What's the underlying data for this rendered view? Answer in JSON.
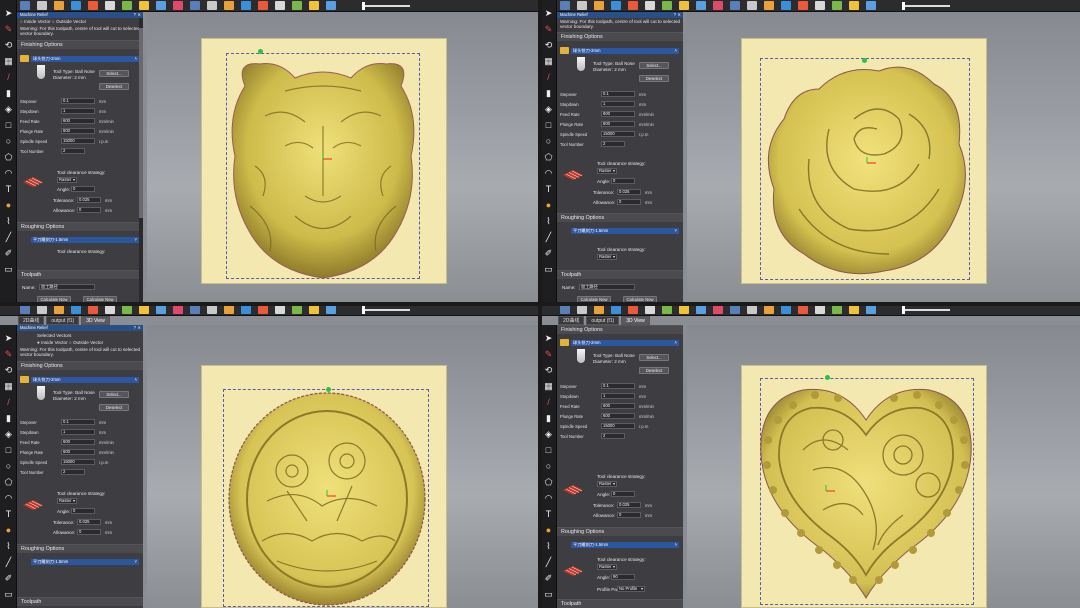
{
  "colors": {
    "accent": "#2d56a0",
    "relief": "#d9c85a",
    "sheet": "#f3e8b0",
    "box": "#5b5bb0"
  },
  "toolbar_icons": [
    "select-icon",
    "arrange-icon",
    "move-icon",
    "pointer-icon",
    "layers-icon",
    "measure-icon",
    "cube-icon",
    "box-icon",
    "diamond-icon",
    "box-icon",
    "box-icon",
    "box-icon",
    "diamond-icon",
    "box-icon",
    "lightbulb-icon",
    "box-icon",
    "box-icon",
    "circle-icon",
    "pie-icon"
  ],
  "left_tools": [
    "select-arrow-icon",
    "pen-icon",
    "transform-icon",
    "grid-icon",
    "brush-icon",
    "eraser-icon",
    "sculpt-icon",
    "rectangle-icon",
    "circle-icon",
    "pentagon-icon",
    "arc-icon",
    "text-icon",
    "drop-icon",
    "pipette-icon",
    "knife-icon",
    "pen2-icon",
    "erase2-icon"
  ],
  "tabs": [
    "2D曲线",
    "output (f1)",
    "3D View"
  ],
  "panel": {
    "title": "Machine Relief",
    "selected_vectors_label": "Selected Vectors",
    "inside_vector": "Inside Vector",
    "outside_vector": "Outside Vector",
    "warning": "Warning: For this toolpath, centre of tool will cut to selected vector boundary.",
    "finishing_header": "Finishing Options",
    "finishing_tool": "球头铣刀-2mm",
    "tool_type": "Tool Type: Ball Nose",
    "diameter": "Diameter: 2 mm",
    "select_btn": "Select...",
    "deselect_btn": "Deselect",
    "fields": [
      {
        "label": "Stepover",
        "value": "0.1",
        "unit": "mm"
      },
      {
        "label": "Stepdown",
        "value": "1",
        "unit": "mm"
      },
      {
        "label": "Feed Rate",
        "value": "600",
        "unit": "mm/min"
      },
      {
        "label": "Plunge Rate",
        "value": "600",
        "unit": "mm/min"
      },
      {
        "label": "Spindle Speed",
        "value": "15000",
        "unit": "r.p.m"
      },
      {
        "label": "Tool Number",
        "value": "2",
        "unit": ""
      }
    ],
    "clearance_label": "Tool clearance strategy:",
    "strategy_value": "Raster",
    "angle_label": "Angle:",
    "angle_value": "0",
    "angle_value_alt": "90",
    "tolerance_label": "Tolerance:",
    "tolerance_value": "0.025",
    "allowance_label": "Allowance:",
    "allowance_value": "0",
    "unit_mm": "mm",
    "roughing_header": "Roughing Options",
    "roughing_tool": "平刀雕刻刀-1.5mm",
    "profile_pass_label": "Profile Pass:",
    "profile_pass_value": "No Profile",
    "toolpath_header": "Toolpath",
    "name_label": "Name:",
    "name_value": "加工路径",
    "calc_btn": "Calculate Now",
    "calc_btn2": "Calculate Now"
  }
}
